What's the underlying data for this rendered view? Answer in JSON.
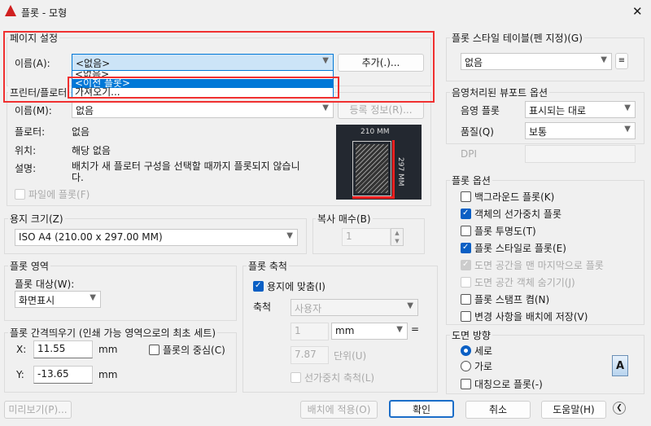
{
  "window": {
    "title": "플롯 - 모형",
    "close": "✕"
  },
  "page_setup": {
    "group": "페이지 설정",
    "name_label": "이름(A):",
    "name_value": "<없음>",
    "add_button": "추가(.)...",
    "dropdown_options": [
      "<없음>",
      "<이전 플롯>",
      "가져오기..."
    ],
    "selected_index": 1
  },
  "printer": {
    "group": "프린터/플로터",
    "name_label": "이름(M):",
    "name_value": "없음",
    "properties_button": "등록 정보(R)...",
    "plotter_label": "플로터:",
    "plotter_value": "없음",
    "location_label": "위치:",
    "location_value": "해당 없음",
    "description_label": "설명:",
    "description_value": "배치가 새 플로터 구성을 선택할 때까지 플롯되지 않습니다.",
    "plot_to_file": "파일에 플롯(F)",
    "preview_width": "210 MM",
    "preview_height": "297 MM"
  },
  "paper_size": {
    "group": "용지 크기(Z)",
    "value": "ISO A4 (210.00 x 297.00 MM)"
  },
  "copies": {
    "group": "복사 매수(B)",
    "value": "1"
  },
  "plot_area": {
    "group": "플롯 영역",
    "what_label": "플롯 대상(W):",
    "what_value": "화면표시"
  },
  "plot_offset": {
    "group": "플롯 간격띄우기 (인쇄 가능 영역으로의 최초 세트)",
    "x_label": "X:",
    "x_value": "11.55",
    "y_label": "Y:",
    "y_value": "-13.65",
    "unit": "mm",
    "center": "플롯의 중심(C)"
  },
  "plot_scale": {
    "group": "플롯 축척",
    "fit": "용지에 맞춤(I)",
    "scale_label": "축척",
    "scale_value": "사용자",
    "value1": "1",
    "unit_value": "mm",
    "equals": "=",
    "value2": "7.87",
    "units_label": "단위(U)",
    "lineweights": "선가중치 축척(L)"
  },
  "style_table": {
    "group": "플롯 스타일 테이블(펜 지정)(G)",
    "value": "없음"
  },
  "shaded": {
    "group": "음영처리된 뷰포트 옵션",
    "shade_label": "음영 플롯",
    "shade_value": "표시되는 대로",
    "quality_label": "품질(Q)",
    "quality_value": "보통",
    "dpi_label": "DPI"
  },
  "options": {
    "group": "플롯 옵션",
    "items": [
      {
        "label": "백그라운드 플롯(K)",
        "checked": false,
        "enabled": true
      },
      {
        "label": "객체의 선가중치 플롯",
        "checked": true,
        "enabled": true
      },
      {
        "label": "플롯 투명도(T)",
        "checked": false,
        "enabled": true
      },
      {
        "label": "플롯 스타일로 플롯(E)",
        "checked": true,
        "enabled": true
      },
      {
        "label": "도면 공간을 맨 마지막으로 플롯",
        "checked": true,
        "enabled": false
      },
      {
        "label": "도면 공간 객체 숨기기(J)",
        "checked": false,
        "enabled": false
      },
      {
        "label": "플롯 스탬프 켬(N)",
        "checked": false,
        "enabled": true
      },
      {
        "label": "변경 사항을 배치에 저장(V)",
        "checked": false,
        "enabled": true
      }
    ]
  },
  "orientation": {
    "group": "도면 방향",
    "portrait": "세로",
    "landscape": "가로",
    "upside_down": "대칭으로 플롯(-)",
    "icon_letter": "A"
  },
  "footer": {
    "preview": "미리보기(P)...",
    "apply": "배치에 적용(O)",
    "ok": "확인",
    "cancel": "취소",
    "help": "도움말(H)",
    "collapse": "❮"
  }
}
